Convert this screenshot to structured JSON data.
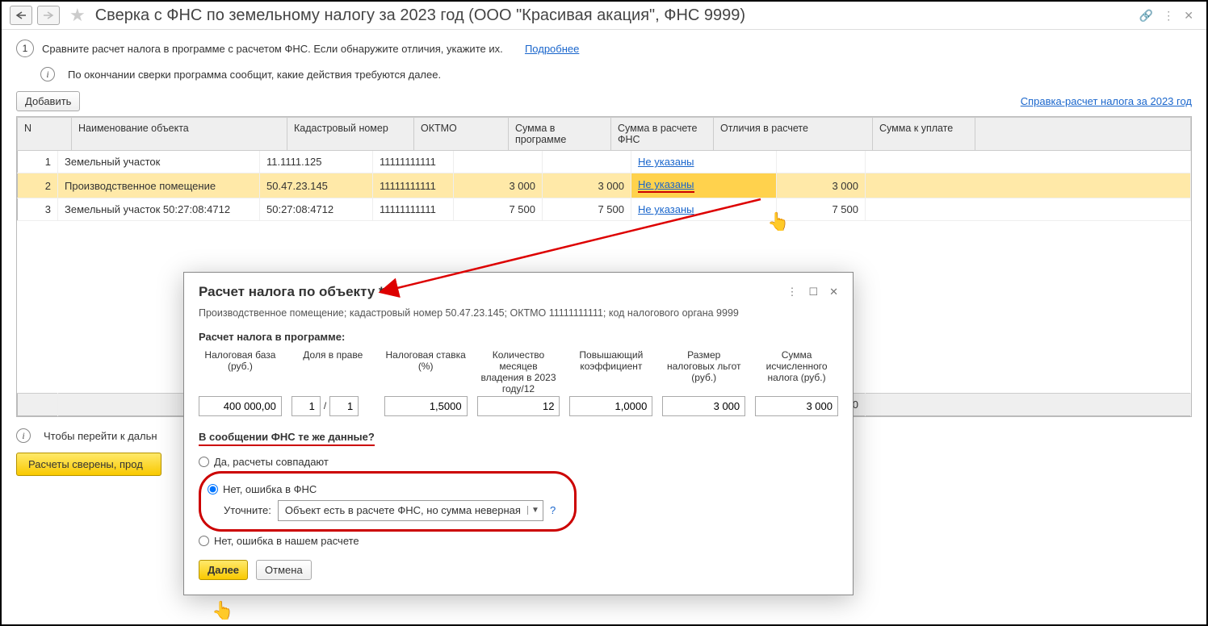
{
  "header": {
    "title": "Сверка с ФНС по земельному налогу за 2023 год (ООО \"Красивая акация\", ФНС 9999)"
  },
  "step": {
    "num": "1",
    "text": "Сравните расчет налога в программе с расчетом ФНС. Если обнаружите отличия, укажите их.",
    "more": "Подробнее",
    "info": "По окончании сверки программа сообщит, какие действия требуются далее."
  },
  "toolbar": {
    "add": "Добавить",
    "report_link": "Справка-расчет налога за 2023 год"
  },
  "columns": {
    "n": "N",
    "name": "Наименование объекта",
    "cad": "Кадастровый номер",
    "oktmo": "ОКТМО",
    "sum_prog": "Сумма в программе",
    "sum_fns": "Сумма в расчете ФНС",
    "diff": "Отличия в расчете",
    "sum_due": "Сумма к уплате"
  },
  "rows": [
    {
      "n": "1",
      "name": "Земельный участок",
      "cad": "11.1111.125",
      "oktmo": "11111111111",
      "sum_prog": "",
      "sum_fns": "",
      "diff": "Не указаны",
      "sum_due": ""
    },
    {
      "n": "2",
      "name": "Производственное помещение",
      "cad": "50.47.23.145",
      "oktmo": "11111111111",
      "sum_prog": "3 000",
      "sum_fns": "3 000",
      "diff": "Не указаны",
      "sum_due": "3 000"
    },
    {
      "n": "3",
      "name": "Земельный участок  50:27:08:4712",
      "cad": "50:27:08:4712",
      "oktmo": "11111111111",
      "sum_prog": "7 500",
      "sum_fns": "7 500",
      "diff": "Не указаны",
      "sum_due": "7 500"
    }
  ],
  "totals": {
    "sum_due": "10 500"
  },
  "footer": {
    "hint": "Чтобы перейти к дальн",
    "reconcile_btn": "Расчеты сверены, прод"
  },
  "dialog": {
    "title": "Расчет налога по объекту *",
    "subtitle": "Производственное помещение; кадастровый номер 50.47.23.145; ОКТМО 11111111111; код налогового органа 9999",
    "section": "Расчет налога в программе:",
    "cols": {
      "base": "Налоговая база (руб.)",
      "share": "Доля в праве",
      "rate": "Налоговая ставка (%)",
      "months": "Количество месяцев владения в 2023 году/12",
      "coef": "Повышаю­щий коэффици­ент",
      "relief": "Размер налоговых льгот (руб.)",
      "tax": "Сумма исчисленного налога (руб.)"
    },
    "vals": {
      "base": "400 000,00",
      "share_a": "1",
      "share_b": "1",
      "rate": "1,5000",
      "months": "12",
      "coef": "1,0000",
      "relief": "3 000",
      "tax": "3 000"
    },
    "question": "В сообщении ФНС те же данные?",
    "opt_yes": "Да, расчеты совпадают",
    "opt_fns": "Нет, ошибка в ФНС",
    "opt_our": "Нет, ошибка в нашем расчете",
    "clarify_label": "Уточните:",
    "clarify_value": "Объект есть в расчете ФНС, но сумма неверная",
    "next": "Далее",
    "cancel": "Отмена"
  }
}
